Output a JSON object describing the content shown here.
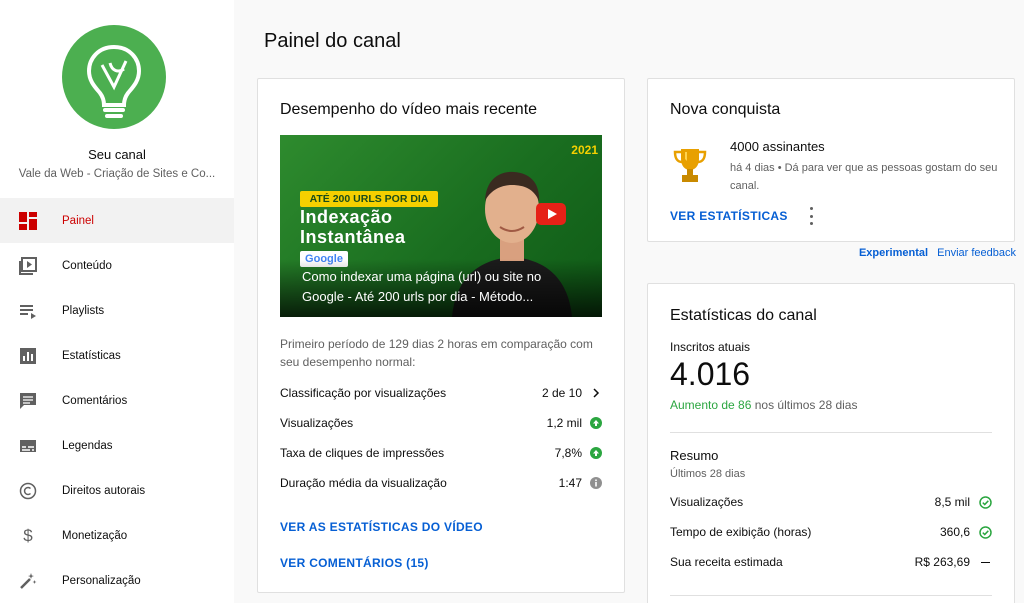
{
  "sidebar": {
    "channel_label": "Seu canal",
    "channel_name": "Vale da Web - Criação de Sites e Co...",
    "items": [
      {
        "label": "Painel",
        "icon": "dashboard-icon"
      },
      {
        "label": "Conteúdo",
        "icon": "content-icon"
      },
      {
        "label": "Playlists",
        "icon": "playlists-icon"
      },
      {
        "label": "Estatísticas",
        "icon": "analytics-icon"
      },
      {
        "label": "Comentários",
        "icon": "comments-icon"
      },
      {
        "label": "Legendas",
        "icon": "subtitles-icon"
      },
      {
        "label": "Direitos autorais",
        "icon": "copyright-icon"
      },
      {
        "label": "Monetização",
        "icon": "dollar-icon"
      },
      {
        "label": "Personalização",
        "icon": "magic-wand-icon"
      }
    ]
  },
  "page": {
    "title": "Painel do canal"
  },
  "video_card": {
    "title": "Desempenho do vídeo mais recente",
    "thumbnail": {
      "year": "2021",
      "badge": "ATÉ 200 URLS POR DIA",
      "headline_1": "Indexação",
      "headline_2": "Instantânea",
      "google": "Google",
      "caption_1": "Como indexar uma página (url) ou site no",
      "caption_2": "Google - Até 200 urls por dia - Método..."
    },
    "description": "Primeiro período de 129 dias 2 horas em comparação com seu desempenho normal:",
    "rows": [
      {
        "label": "Classificação por visualizações",
        "value": "2 de 10"
      },
      {
        "label": "Visualizações",
        "value": "1,2 mil"
      },
      {
        "label": "Taxa de cliques de impressões",
        "value": "7,8%"
      },
      {
        "label": "Duração média da visualização",
        "value": "1:47"
      }
    ],
    "link_stats": "VER AS ESTATÍSTICAS DO VÍDEO",
    "link_comments": "VER COMENTÁRIOS (15)"
  },
  "achievement_card": {
    "title": "Nova conquista",
    "name": "4000 assinantes",
    "description": "há 4 dias • Dá para ver que as pessoas gostam do seu canal.",
    "link": "VER ESTATÍSTICAS"
  },
  "experimental": {
    "label": "Experimental",
    "feedback": "Enviar feedback"
  },
  "stats_card": {
    "title": "Estatísticas do canal",
    "subscribers_label": "Inscritos atuais",
    "subscribers_value": "4.016",
    "growth_highlight": "Aumento de 86",
    "growth_rest": " nos últimos 28 dias",
    "summary_title": "Resumo",
    "summary_period": "Últimos 28 dias",
    "rows": [
      {
        "label": "Visualizações",
        "value": "8,5 mil"
      },
      {
        "label": "Tempo de exibição (horas)",
        "value": "360,6"
      },
      {
        "label": "Sua receita estimada",
        "value": "R$ 263,69"
      }
    ]
  },
  "colors": {
    "accent_red": "#cc0000",
    "link_blue": "#065fd4",
    "green": "#2ba640",
    "avatar_green": "#4caf50"
  }
}
